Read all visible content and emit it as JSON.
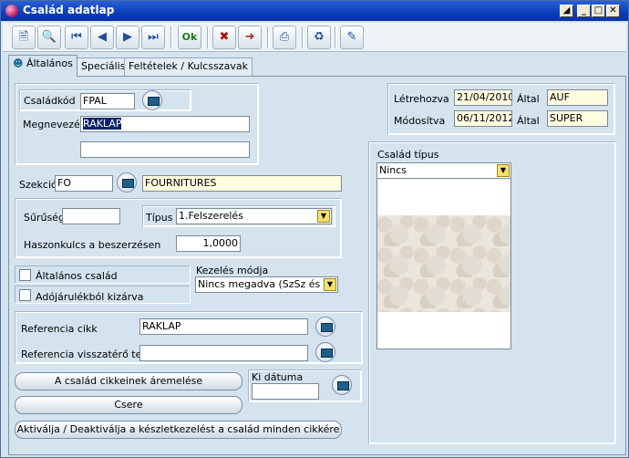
{
  "window": {
    "title": "Család adatlap"
  },
  "tabs": [
    "Általános",
    "Speciális",
    "Feltételek / Kulcsszavak"
  ],
  "general": {
    "csaladkod_label": "Családkód",
    "csaladkod_value": "FPAL",
    "megnevezes_label": "Megnevezés",
    "megnevezes_value": "RAKLAP",
    "megnevezes2_value": "",
    "letrehozva_label": "Létrehozva",
    "letrehozva_date": "21/04/2010",
    "letrehozva_altal_label": "Által",
    "letrehozva_user": "AUF",
    "modositva_label": "Módosítva",
    "modositva_date": "06/11/2012",
    "modositva_altal_label": "Által",
    "modositva_user": "SUPER",
    "szekcio_label": "Szekció",
    "szekcio_code": "FO",
    "szekcio_name": "FOURNITURES",
    "suruseg_label": "Sűrűség",
    "suruseg_value": "",
    "tipus_label": "Típus",
    "tipus_value": "1.Felszerelés",
    "haszonkulcs_label": "Haszonkulcs a beszerzésen",
    "haszonkulcs_value": "1,0000",
    "altalanos_csalad_label": "Általános család",
    "adojarulek_label": "Adójárulékból kizárva",
    "kezeles_label": "Kezelés módja",
    "kezeles_value": "Nincs megadva (SzSz és TÜ",
    "ref_cikk_label": "Referencia cikk",
    "ref_cikk_value": "RAKLAP",
    "ref_visszatero_label": "Referencia visszatérő termé",
    "ref_visszatero_value": "",
    "csalad_tipus_label": "Család típus",
    "csalad_tipus_value": "Nincs",
    "ki_datuma_label": "Ki dátuma",
    "ki_datuma_value": "",
    "btn_aremeles": "A család cikkeinek áremelése",
    "btn_csere": "Csere",
    "btn_aktival": "Aktiválja / Deaktiválja a készletkezelést a család minden cikkére"
  }
}
